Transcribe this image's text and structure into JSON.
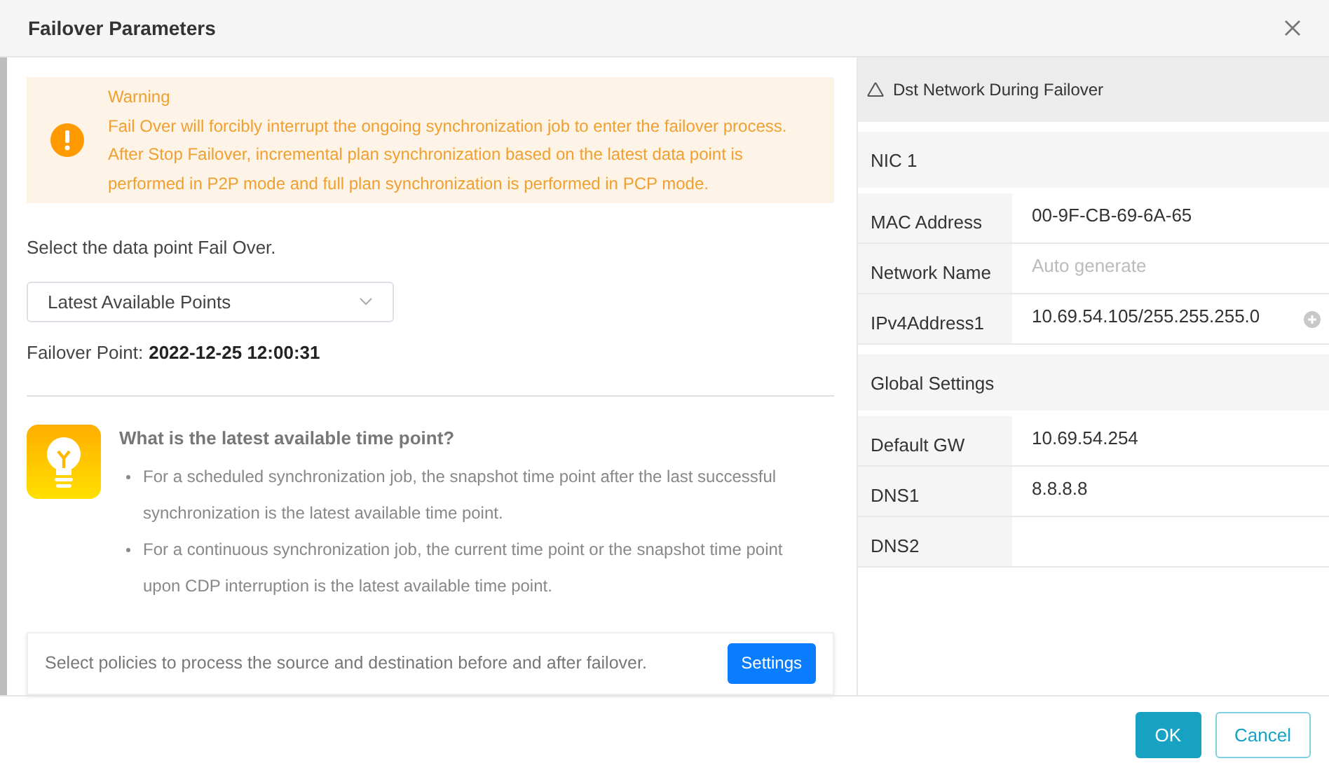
{
  "dialog": {
    "title": "Failover Parameters"
  },
  "warning": {
    "title": "Warning",
    "lines": [
      "Fail Over will forcibly interrupt the ongoing synchronization job to enter the failover process.",
      "After Stop Failover, incremental plan synchronization based on the latest data point is performed in P2P mode and full plan synchronization is performed in PCP mode."
    ]
  },
  "select_label": "Select the data point Fail Over.",
  "select": {
    "value": "Latest Available Points"
  },
  "failover_point": {
    "label": "Failover Point:",
    "value": "2022-12-25 12:00:31"
  },
  "tip": {
    "title": "What is the latest available time point?",
    "items": [
      "For a scheduled synchronization job, the snapshot time point after the last successful synchronization is the latest available time point.",
      "For a continuous synchronization job, the current time point or the snapshot time point upon CDP interruption is the latest available time point."
    ]
  },
  "policy": {
    "text": "Select policies to process the source and destination before and after failover.",
    "button": "Settings"
  },
  "network": {
    "title": "Dst Network During Failover",
    "rows": [
      {
        "kind": "section",
        "label": "NIC 1"
      },
      {
        "kind": "field",
        "label": "MAC Address",
        "value": "00-9F-CB-69-6A-65"
      },
      {
        "kind": "field",
        "label": "Network Name",
        "placeholder": "Auto generate"
      },
      {
        "kind": "field",
        "label": "IPv4Address1",
        "value": "10.69.54.105/255.255.255.0",
        "addable": true
      },
      {
        "kind": "section",
        "label": "Global Settings"
      },
      {
        "kind": "field",
        "label": "Default GW",
        "value": "10.69.54.254"
      },
      {
        "kind": "field",
        "label": "DNS1",
        "value": "8.8.8.8"
      },
      {
        "kind": "field",
        "label": "DNS2"
      }
    ]
  },
  "buttons": [
    {
      "kind": "primary",
      "label": "OK"
    },
    {
      "kind": "secondary",
      "label": "Cancel"
    }
  ]
}
